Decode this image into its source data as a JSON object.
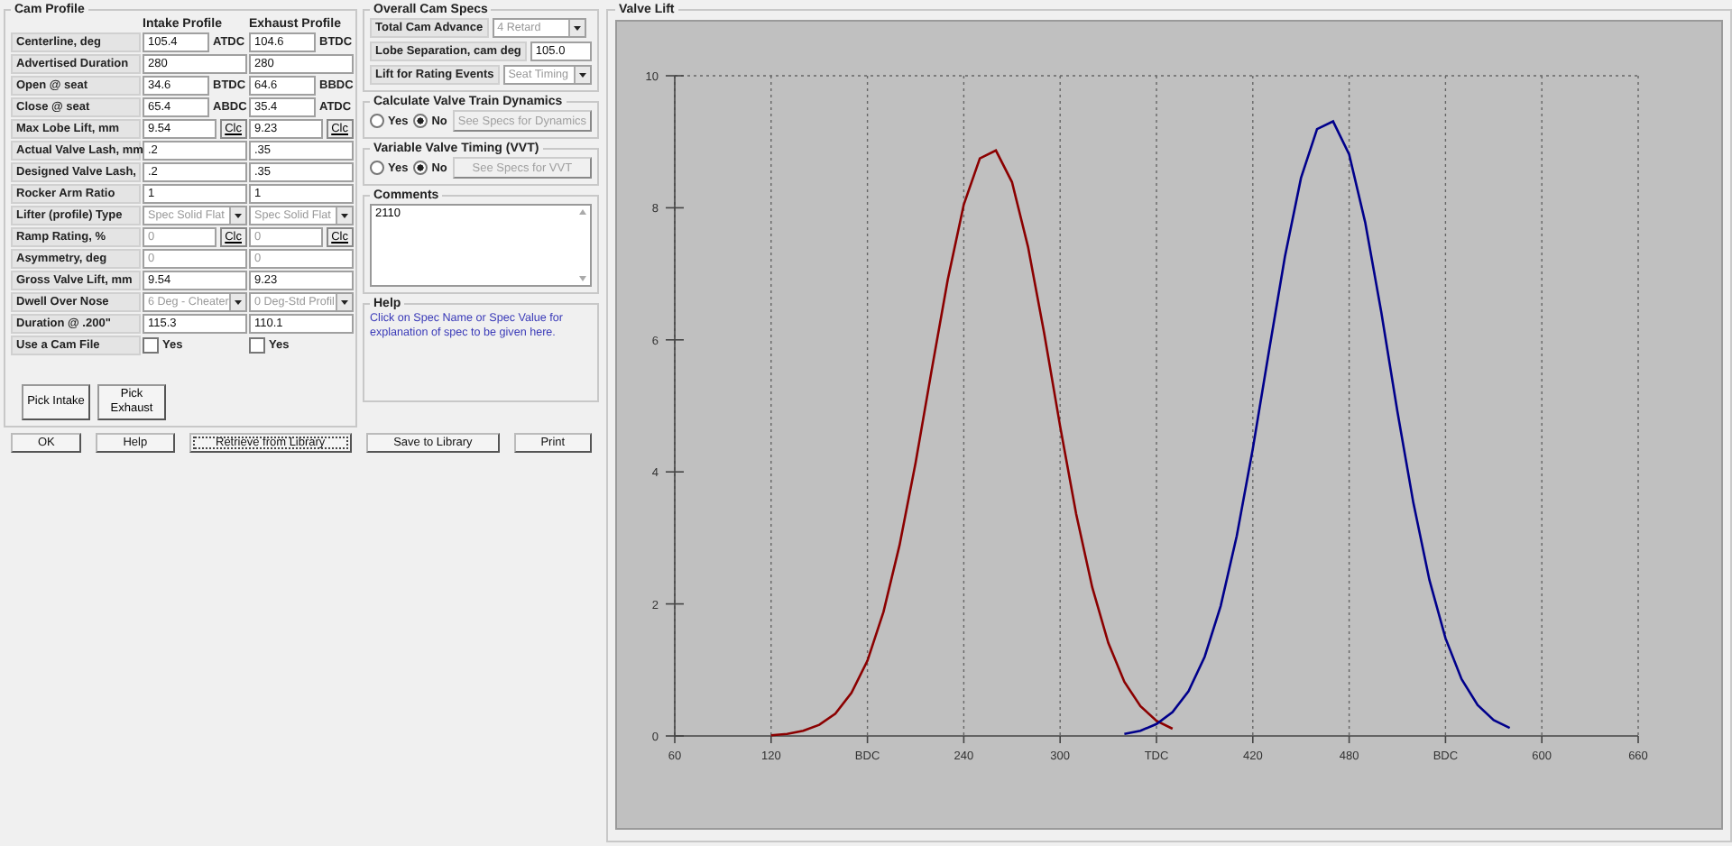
{
  "cam_profile": {
    "title": "Cam Profile",
    "columns": [
      "Intake Profile",
      "Exhaust Profile"
    ],
    "rows": [
      {
        "label": "Centerline, deg",
        "kind": "unit",
        "intake": {
          "value": "105.4",
          "unit": "ATDC",
          "disabled": false
        },
        "exhaust": {
          "value": "104.6",
          "unit": "BTDC",
          "disabled": false
        }
      },
      {
        "label": "Advertised Duration",
        "kind": "text",
        "intake": {
          "value": "280",
          "disabled": false
        },
        "exhaust": {
          "value": "280",
          "disabled": false
        }
      },
      {
        "label": "Open @ seat",
        "kind": "unit",
        "intake": {
          "value": "34.6",
          "unit": "BTDC",
          "disabled": false
        },
        "exhaust": {
          "value": "64.6",
          "unit": "BBDC",
          "disabled": false
        }
      },
      {
        "label": "Close @ seat",
        "kind": "unit",
        "intake": {
          "value": "65.4",
          "unit": "ABDC",
          "disabled": false
        },
        "exhaust": {
          "value": "35.4",
          "unit": "ATDC",
          "disabled": false
        }
      },
      {
        "label": "Max Lobe Lift, mm",
        "kind": "calc",
        "intake": {
          "value": "9.54",
          "button": "Clc",
          "disabled": false
        },
        "exhaust": {
          "value": "9.23",
          "button": "Clc",
          "disabled": false
        }
      },
      {
        "label": "Actual Valve Lash, mm",
        "kind": "text",
        "intake": {
          "value": ".2",
          "disabled": false
        },
        "exhaust": {
          "value": ".35",
          "disabled": false
        }
      },
      {
        "label": "Designed Valve Lash,",
        "kind": "text",
        "intake": {
          "value": ".2",
          "disabled": false
        },
        "exhaust": {
          "value": ".35",
          "disabled": false
        }
      },
      {
        "label": "Rocker Arm Ratio",
        "kind": "text",
        "intake": {
          "value": "1",
          "disabled": false
        },
        "exhaust": {
          "value": "1",
          "disabled": false
        }
      },
      {
        "label": "Lifter (profile) Type",
        "kind": "select",
        "intake": {
          "value": "Spec Solid Flat",
          "disabled": true
        },
        "exhaust": {
          "value": "Spec Solid Flat",
          "disabled": true
        }
      },
      {
        "label": "Ramp Rating, %",
        "kind": "calc",
        "intake": {
          "value": "0",
          "button": "Clc",
          "disabled": true
        },
        "exhaust": {
          "value": "0",
          "button": "Clc",
          "disabled": true
        }
      },
      {
        "label": "Asymmetry, deg",
        "kind": "text",
        "intake": {
          "value": "0",
          "disabled": true
        },
        "exhaust": {
          "value": "0",
          "disabled": true
        }
      },
      {
        "label": "Gross Valve Lift, mm",
        "kind": "text",
        "intake": {
          "value": "9.54",
          "disabled": false
        },
        "exhaust": {
          "value": "9.23",
          "disabled": false
        }
      },
      {
        "label": "Dwell Over Nose",
        "kind": "select",
        "intake": {
          "value": "6 Deg - Cheater",
          "disabled": true
        },
        "exhaust": {
          "value": "0 Deg-Std Profil",
          "disabled": true
        }
      },
      {
        "label": "Duration @ .200\"",
        "kind": "text",
        "intake": {
          "value": "115.3",
          "disabled": false
        },
        "exhaust": {
          "value": "110.1",
          "disabled": false
        }
      },
      {
        "label": "Use a Cam File",
        "kind": "checkbox",
        "intake": {
          "label": "Yes",
          "checked": false
        },
        "exhaust": {
          "label": "Yes",
          "checked": false
        }
      }
    ],
    "buttons": [
      "Pick Intake",
      "Pick Exhaust"
    ]
  },
  "overall_cam_specs": {
    "title": "Overall Cam Specs",
    "fields": [
      {
        "label": "Total Cam Advance",
        "kind": "select",
        "value": "4 Retard",
        "disabled": true
      },
      {
        "label": "Lobe Separation, cam deg",
        "kind": "text",
        "value": "105.0",
        "disabled": false
      },
      {
        "label": "Lift for Rating Events",
        "kind": "select",
        "value": "Seat Timing",
        "disabled": true
      }
    ]
  },
  "valve_train_dynamics": {
    "title": "Calculate Valve Train Dynamics",
    "options": [
      {
        "label": "Yes",
        "selected": false
      },
      {
        "label": "No",
        "selected": true
      }
    ],
    "button": {
      "label": "See Specs for Dynamics",
      "disabled": true
    }
  },
  "variable_valve_timing": {
    "title": "Variable Valve Timing (VVT)",
    "options": [
      {
        "label": "Yes",
        "selected": false
      },
      {
        "label": "No",
        "selected": true
      }
    ],
    "button": {
      "label": "See Specs for VVT",
      "disabled": true
    }
  },
  "comments": {
    "title": "Comments",
    "value": "2110"
  },
  "help": {
    "title": "Help",
    "text": "Click on Spec Name or Spec Value for explanation of spec to be given here."
  },
  "buttons": [
    {
      "label": "OK",
      "focused": false
    },
    {
      "label": "Help",
      "focused": false
    },
    {
      "label": "Retrieve from Library",
      "focused": true
    },
    {
      "label": "Save to Library",
      "focused": false
    },
    {
      "label": "Print",
      "focused": false
    }
  ],
  "valve_lift": {
    "title": "Valve Lift",
    "chart_data": {
      "type": "line",
      "grid": true,
      "xlim": [
        60,
        660
      ],
      "ylim": [
        0,
        10
      ],
      "xticks": [
        60,
        120,
        {
          "value": 180,
          "label": "BDC"
        },
        240,
        300,
        {
          "value": 360,
          "label": "TDC"
        },
        420,
        480,
        {
          "value": 540,
          "label": "BDC"
        },
        600,
        660
      ],
      "yticks": [
        0,
        2,
        4,
        6,
        8,
        10
      ],
      "x": [
        120,
        130,
        140,
        150,
        160,
        170,
        180,
        190,
        200,
        210,
        220,
        230,
        240,
        250,
        260,
        270,
        280,
        290,
        300,
        310,
        320,
        330,
        340,
        350,
        360,
        370,
        380,
        390,
        400,
        410,
        420,
        430,
        440,
        450,
        460,
        470,
        480,
        490,
        500,
        510,
        520,
        530,
        540,
        550,
        560,
        570,
        580
      ],
      "series": [
        {
          "color": "#8b0000",
          "values": [
            0.01,
            0.03,
            0.08,
            0.17,
            0.34,
            0.65,
            1.14,
            1.88,
            2.89,
            4.14,
            5.54,
            6.91,
            8.05,
            8.75,
            8.87,
            8.39,
            7.41,
            6.11,
            4.69,
            3.36,
            2.25,
            1.41,
            0.82,
            0.45,
            0.23,
            0.11,
            null,
            null,
            null,
            null,
            null,
            null,
            null,
            null,
            null,
            null,
            null,
            null,
            null,
            null,
            null,
            null,
            null,
            null,
            null,
            null,
            null
          ]
        },
        {
          "color": "#00008b",
          "values": [
            null,
            null,
            null,
            null,
            null,
            null,
            null,
            null,
            null,
            null,
            null,
            null,
            null,
            null,
            null,
            null,
            null,
            null,
            null,
            null,
            null,
            null,
            0.03,
            0.08,
            0.18,
            0.36,
            0.68,
            1.2,
            1.97,
            3.03,
            4.35,
            5.82,
            7.26,
            8.45,
            9.19,
            9.31,
            8.81,
            7.78,
            6.42,
            4.92,
            3.53,
            2.36,
            1.48,
            0.86,
            0.47,
            0.24,
            0.12
          ]
        }
      ]
    }
  }
}
